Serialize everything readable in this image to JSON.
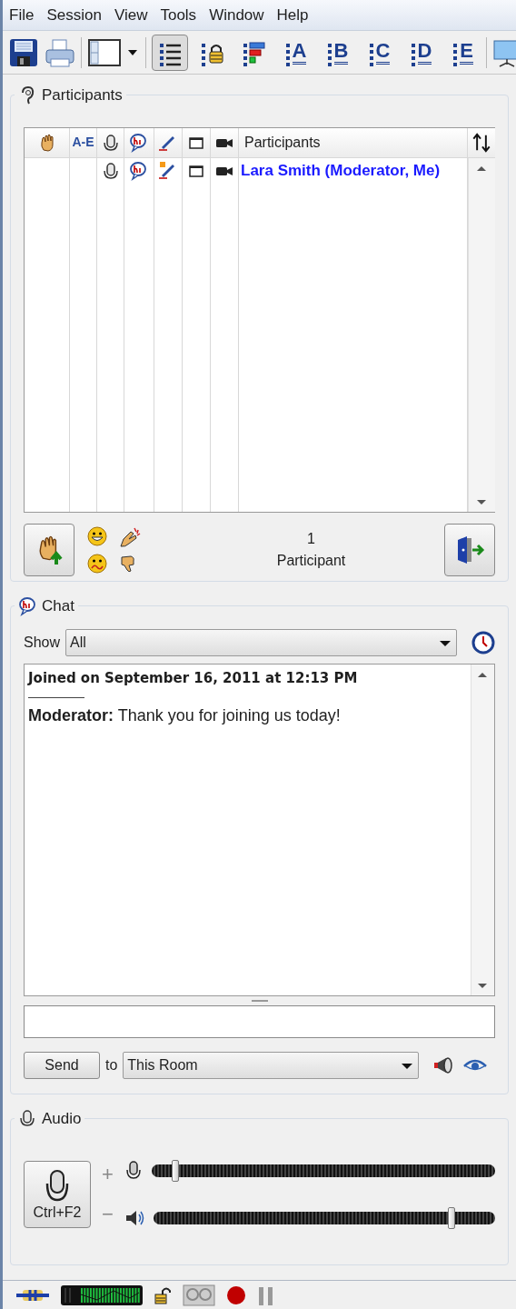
{
  "menu": [
    "File",
    "Session",
    "View",
    "Tools",
    "Window",
    "Help"
  ],
  "toolbar": {
    "view_buttons": [
      {
        "kind": "list",
        "selected": true
      },
      {
        "kind": "lock",
        "selected": false
      },
      {
        "kind": "status",
        "selected": false
      },
      {
        "kind": "letter",
        "label": "A",
        "selected": false
      },
      {
        "kind": "letter",
        "label": "B",
        "selected": false
      },
      {
        "kind": "letter",
        "label": "C",
        "selected": false
      },
      {
        "kind": "letter",
        "label": "D",
        "selected": false
      },
      {
        "kind": "letter",
        "label": "E",
        "selected": false
      }
    ]
  },
  "participants_panel": {
    "title": "Participants",
    "columns": [
      {
        "kind": "hand"
      },
      {
        "kind": "text",
        "label": "A-E"
      },
      {
        "kind": "mic"
      },
      {
        "kind": "chat"
      },
      {
        "kind": "pen"
      },
      {
        "kind": "window"
      },
      {
        "kind": "camera"
      },
      {
        "kind": "name",
        "label": "Participants"
      }
    ],
    "rows": [
      {
        "name": "Lara Smith (Moderator, Me)"
      }
    ],
    "count": "1",
    "count_label": "Participant"
  },
  "chat": {
    "title": "Chat",
    "show_label": "Show",
    "filter": "All",
    "messages": [
      {
        "kind": "system",
        "text": "Joined on September 16, 2011 at 12:13 PM"
      },
      {
        "kind": "message",
        "text": "**Moderator:** Thank you for joining us today!"
      }
    ],
    "send_button": "Send",
    "to_label": "to",
    "recipient": "This Room"
  },
  "audio": {
    "title": "Audio",
    "talk_button": "Ctrl+F2",
    "plus": "+",
    "minus": "−",
    "sliders": [
      {
        "kind": "mic",
        "level": 0.06
      },
      {
        "kind": "speaker",
        "level": 0.88
      }
    ]
  }
}
